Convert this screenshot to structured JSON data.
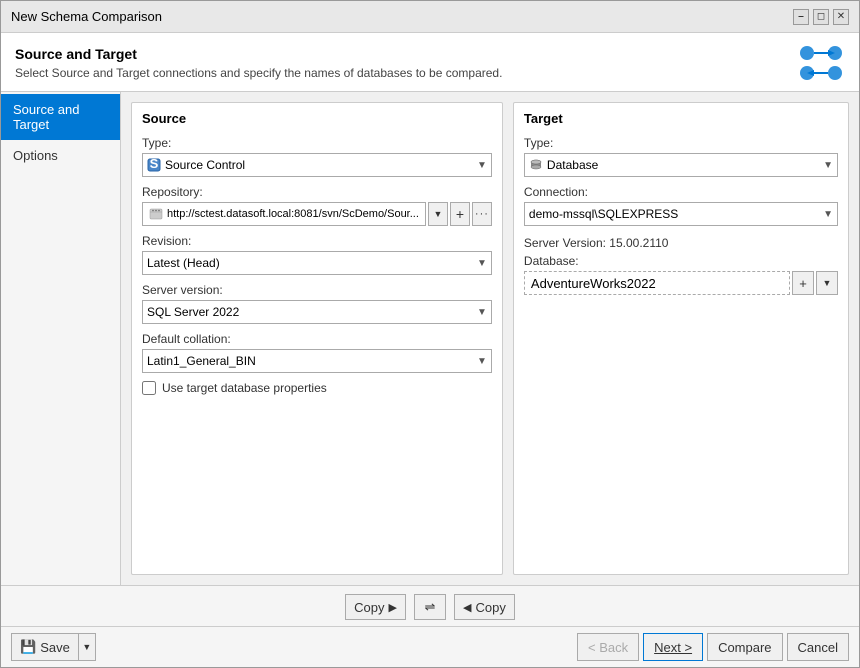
{
  "window": {
    "title": "New Schema Comparison"
  },
  "header": {
    "title": "Source and Target",
    "description": "Select Source and Target connections and specify the names of databases to be compared."
  },
  "sidebar": {
    "items": [
      {
        "id": "source-and-target",
        "label": "Source and Target",
        "active": true
      },
      {
        "id": "options",
        "label": "Options",
        "active": false
      }
    ]
  },
  "source": {
    "panel_title": "Source",
    "type_label": "Type:",
    "type_value": "Source Control",
    "repository_label": "Repository:",
    "repository_value": "http://sctest.datasoft.local:8081/svn/ScDemo/Sour...",
    "revision_label": "Revision:",
    "revision_value": "Latest (Head)",
    "server_version_label": "Server version:",
    "server_version_value": "SQL Server 2022",
    "default_collation_label": "Default collation:",
    "default_collation_value": "Latin1_General_BIN",
    "checkbox_label": "Use target database properties"
  },
  "target": {
    "panel_title": "Target",
    "type_label": "Type:",
    "type_value": "Database",
    "connection_label": "Connection:",
    "connection_value": "demo-mssql\\SQLEXPRESS",
    "server_version_text": "Server Version: 15.00.2110",
    "database_label": "Database:",
    "database_value": "AdventureWorks2022"
  },
  "bottom": {
    "copy_left_label": "Copy",
    "copy_right_label": "Copy",
    "swap_icon": "⇌",
    "save_label": "Save",
    "back_label": "< Back",
    "next_label": "Next >",
    "compare_label": "Compare",
    "cancel_label": "Cancel"
  }
}
